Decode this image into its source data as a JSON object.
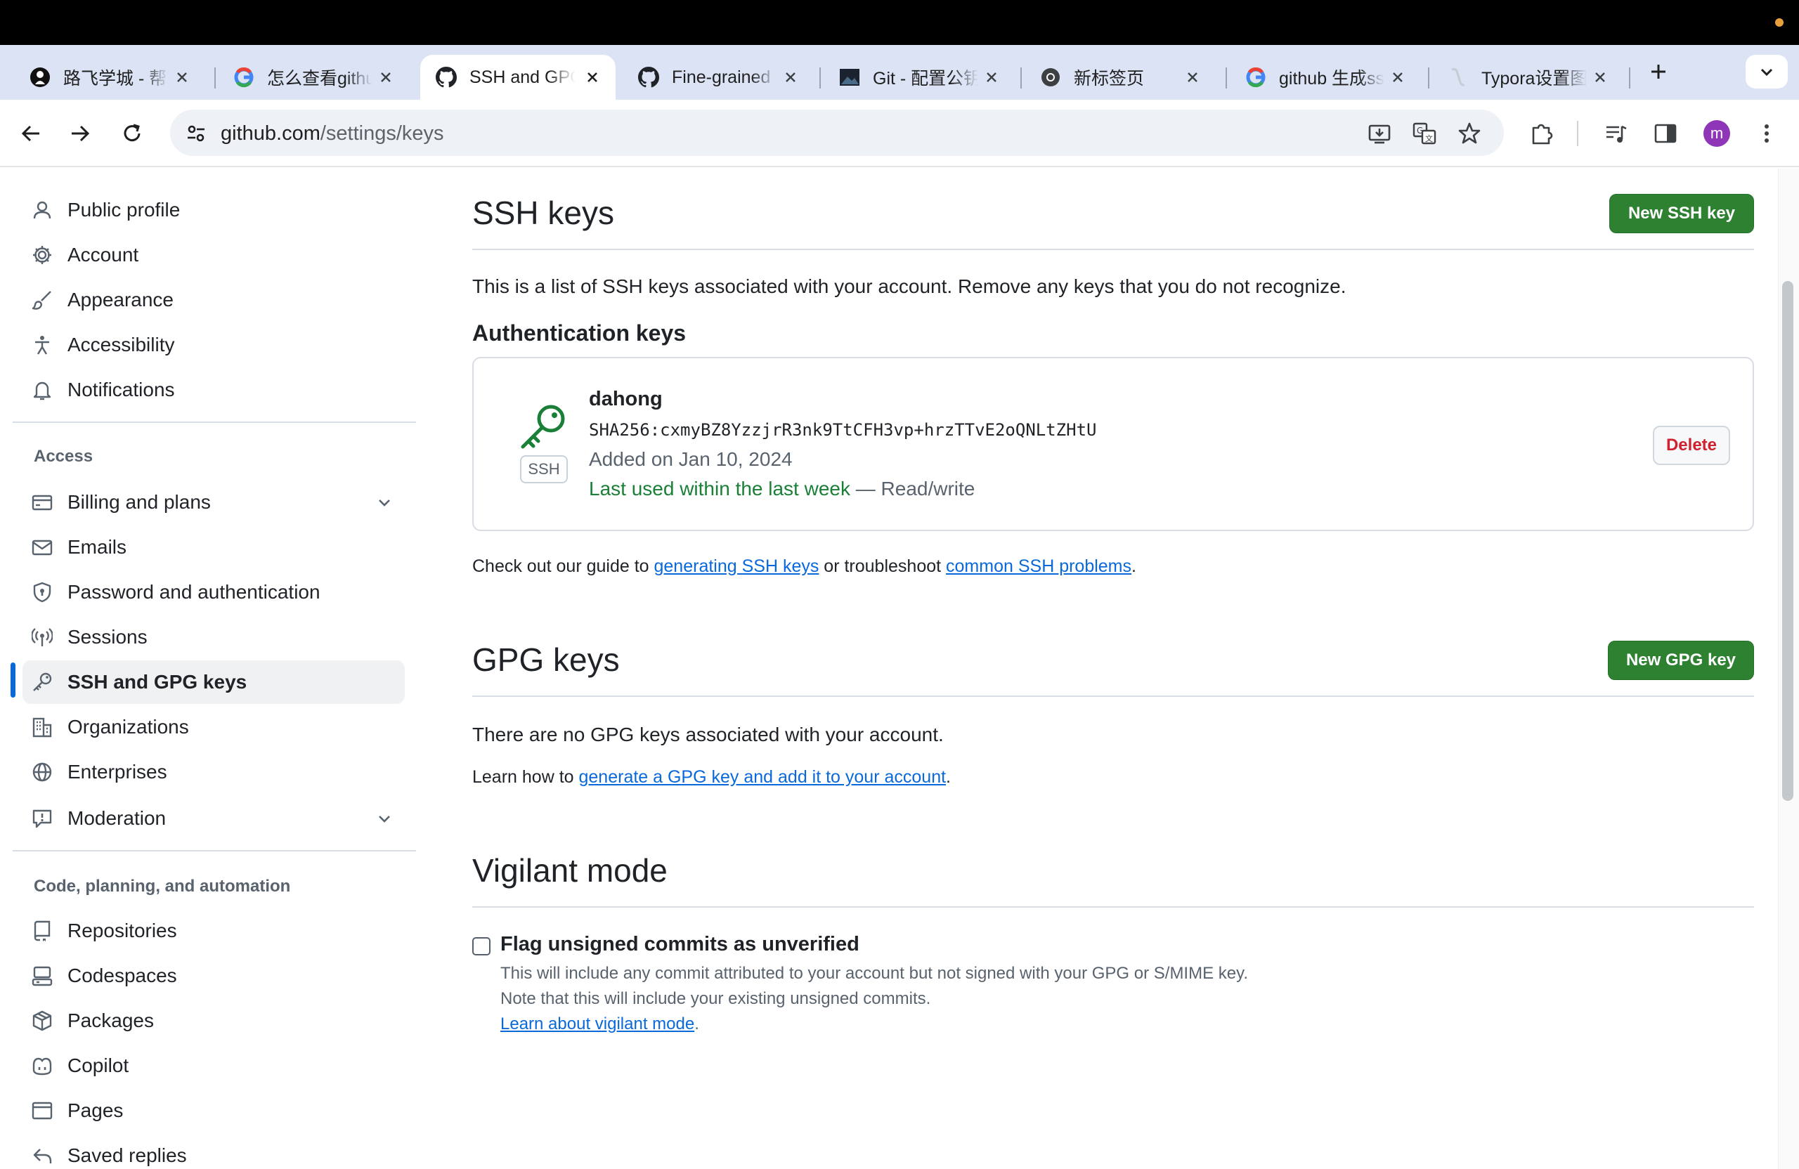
{
  "browser": {
    "tabs": [
      {
        "label": "路飞学城 - 帮助",
        "favicon": "luffy-icon"
      },
      {
        "label": "怎么查看github",
        "favicon": "google-icon"
      },
      {
        "label": "SSH and GPG keys",
        "favicon": "github-icon",
        "active": true
      },
      {
        "label": "Fine-grained",
        "favicon": "github-icon"
      },
      {
        "label": "Git - 配置公钥",
        "favicon": "image-icon"
      },
      {
        "label": "新标签页",
        "favicon": "chrome-icon"
      },
      {
        "label": "github 生成ssh",
        "favicon": "google-icon"
      },
      {
        "label": "Typora设置图",
        "favicon": "typora-icon"
      }
    ],
    "url_host": "github.com",
    "url_path": "/settings/keys",
    "profile_initial": "m"
  },
  "sidebar": {
    "group_main": [
      {
        "label": "Public profile",
        "icon": "person-icon"
      },
      {
        "label": "Account",
        "icon": "gear-icon"
      },
      {
        "label": "Appearance",
        "icon": "paintbrush-icon"
      },
      {
        "label": "Accessibility",
        "icon": "accessibility-icon"
      },
      {
        "label": "Notifications",
        "icon": "bell-icon"
      }
    ],
    "access_heading": "Access",
    "group_access": [
      {
        "label": "Billing and plans",
        "icon": "credit-card-icon",
        "expandable": true
      },
      {
        "label": "Emails",
        "icon": "mail-icon"
      },
      {
        "label": "Password and authentication",
        "icon": "shield-lock-icon"
      },
      {
        "label": "Sessions",
        "icon": "broadcast-icon"
      },
      {
        "label": "SSH and GPG keys",
        "icon": "key-icon",
        "active": true
      },
      {
        "label": "Organizations",
        "icon": "organization-icon"
      },
      {
        "label": "Enterprises",
        "icon": "globe-icon"
      },
      {
        "label": "Moderation",
        "icon": "report-icon",
        "expandable": true
      }
    ],
    "code_heading": "Code, planning, and automation",
    "group_code": [
      {
        "label": "Repositories",
        "icon": "repo-icon"
      },
      {
        "label": "Codespaces",
        "icon": "codespaces-icon"
      },
      {
        "label": "Packages",
        "icon": "package-icon"
      },
      {
        "label": "Copilot",
        "icon": "copilot-icon"
      },
      {
        "label": "Pages",
        "icon": "browser-icon"
      },
      {
        "label": "Saved replies",
        "icon": "reply-icon"
      }
    ]
  },
  "ssh": {
    "title": "SSH keys",
    "new_button": "New SSH key",
    "intro": "This is a list of SSH keys associated with your account. Remove any keys that you do not recognize.",
    "auth_heading": "Authentication keys",
    "key": {
      "badge": "SSH",
      "name": "dahong",
      "fingerprint": "SHA256:cxmyBZ8YzzjrR3nk9TtCFH3vp+hrzTTvE2oQNLtZHtU",
      "added": "Added on Jan 10, 2024",
      "last_used": "Last used within the last week",
      "access": " — Read/write",
      "delete_label": "Delete"
    },
    "guide_prefix": "Check out our guide to ",
    "guide_link1": "generating SSH keys",
    "guide_mid": " or troubleshoot ",
    "guide_link2": "common SSH problems",
    "guide_suffix": "."
  },
  "gpg": {
    "title": "GPG keys",
    "new_button": "New GPG key",
    "empty": "There are no GPG keys associated with your account.",
    "learn_prefix": "Learn how to ",
    "learn_link": "generate a GPG key and add it to your account",
    "learn_suffix": "."
  },
  "vigilant": {
    "title": "Vigilant mode",
    "checkbox_label": "Flag unsigned commits as unverified",
    "checked": false,
    "desc1": "This will include any commit attributed to your account but not signed with your GPG or S/MIME key.",
    "desc2": "Note that this will include your existing unsigned commits.",
    "learn_link": "Learn about vigilant mode",
    "learn_suffix": "."
  }
}
